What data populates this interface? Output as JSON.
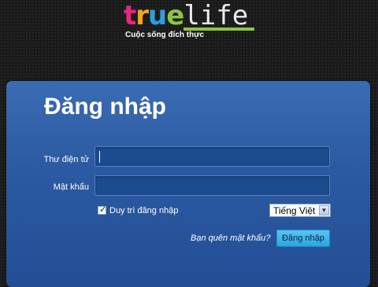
{
  "brand": {
    "logo_letters": [
      "t",
      "r",
      "u",
      "e"
    ],
    "logo_suffix": "life",
    "tagline": "Cuộc sống đích thực",
    "colors": [
      "#e8277e",
      "#f2a51d",
      "#2c9fdc",
      "#8cc63f"
    ]
  },
  "login": {
    "title": "Đăng nhập",
    "email_label": "Thư điện tử",
    "email_value": "",
    "password_label": "Mật khẩu",
    "password_value": "",
    "remember_label": "Duy trì đăng nhập",
    "remember_checked": true,
    "language_selected": "Tiếng Việt",
    "forgot_link": "Bạn quên mật khẩu?",
    "submit_label": "Đăng nhập"
  },
  "colors": {
    "panel": "#2c5ba3",
    "button": "#2aa5e2",
    "background": "#1e1e1e"
  }
}
